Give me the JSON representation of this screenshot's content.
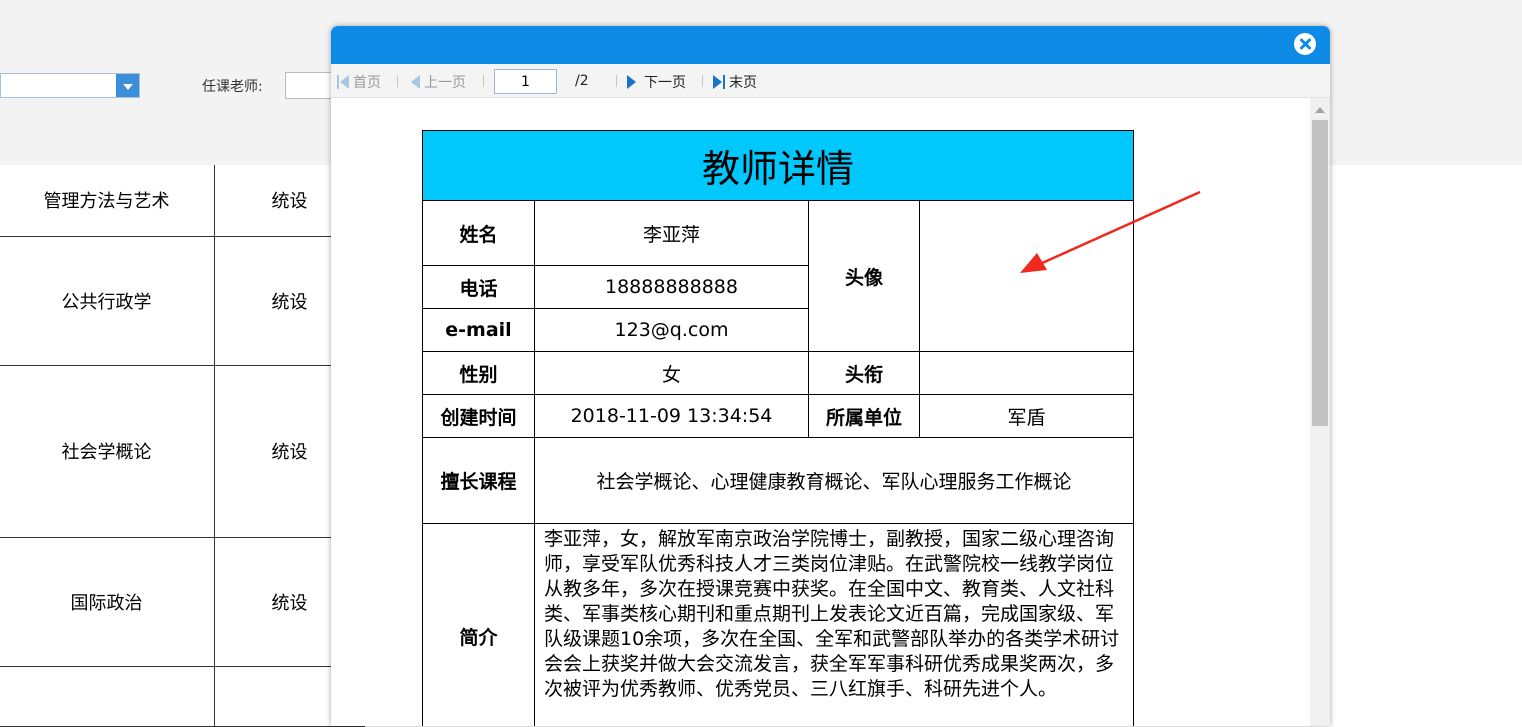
{
  "filter": {
    "teacher_label": "任课老师:",
    "teacher_value": ""
  },
  "courses": [
    {
      "name": "管理方法与艺术",
      "type": "统设"
    },
    {
      "name": "公共行政学",
      "type": "统设"
    },
    {
      "name": "社会学概论",
      "type": "统设"
    },
    {
      "name": "国际政治",
      "type": "统设"
    },
    {
      "name": "",
      "type": ""
    }
  ],
  "pager": {
    "first": "首页",
    "prev": "上一页",
    "current_page": "1",
    "total": "/2",
    "next": "下一页",
    "last": "末页"
  },
  "detail": {
    "title": "教师详情",
    "name_label": "姓名",
    "name": "李亚萍",
    "avatar_label": "头像",
    "phone_label": "电话",
    "phone": "18888888888",
    "email_label": "e-mail",
    "email": "123@q.com",
    "gender_label": "性别",
    "gender": "女",
    "rank_label": "头衔",
    "rank": "",
    "created_label": "创建时间",
    "created": "2018-11-09 13:34:54",
    "unit_label": "所属单位",
    "unit": "军盾",
    "courses_label": "擅长课程",
    "courses": "社会学概论、心理健康教育概论、军队心理服务工作概论",
    "bio_label": "简介",
    "bio": "李亚萍，女，解放军南京政治学院博士，副教授，国家二级心理咨询师，享受军队优秀科技人才三类岗位津贴。在武警院校一线教学岗位从教多年，多次在授课竞赛中获奖。在全国中文、教育类、人文社科类、军事类核心期刊和重点期刊上发表论文近百篇，完成国家级、军队级课题10余项，多次在全国、全军和武警部队举办的各类学术研讨会会上获奖并做大会交流发言，获全军军事科研优秀成果奖两次，多次被评为优秀教师、优秀党员、三八红旗手、科研先进个人。"
  },
  "colors": {
    "header": "#0e8be6",
    "title_bg": "#00c8fd",
    "annotation_arrow": "#f0281e"
  }
}
